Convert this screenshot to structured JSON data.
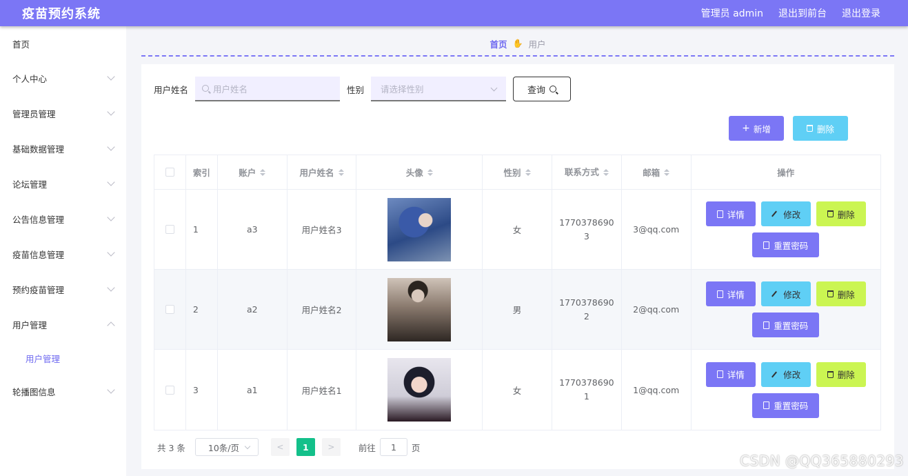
{
  "header": {
    "brand": "疫苗预约系统",
    "admin": "管理员 admin",
    "to_front": "退出到前台",
    "logout": "退出登录"
  },
  "sidebar": {
    "home": "首页",
    "items": [
      {
        "label": "个人中心"
      },
      {
        "label": "管理员管理"
      },
      {
        "label": "基础数据管理"
      },
      {
        "label": "论坛管理"
      },
      {
        "label": "公告信息管理"
      },
      {
        "label": "疫苗信息管理"
      },
      {
        "label": "预约疫苗管理"
      },
      {
        "label": "用户管理",
        "expanded": true
      },
      {
        "label": "轮播图信息"
      }
    ],
    "submenu": "用户管理"
  },
  "breadcrumb": {
    "home": "首页",
    "current": "用户"
  },
  "search": {
    "name_label": "用户姓名",
    "name_placeholder": "用户姓名",
    "gender_label": "性别",
    "gender_placeholder": "请选择性别",
    "query_label": "查询"
  },
  "actions": {
    "add": "新增",
    "delete": "删除"
  },
  "table": {
    "columns": [
      "索引",
      "账户",
      "用户姓名",
      "头像",
      "性别",
      "联系方式",
      "邮箱",
      "操作"
    ],
    "rows": [
      {
        "index": "1",
        "account": "a3",
        "name": "用户姓名3",
        "gender": "女",
        "phone_a": "1770378690",
        "phone_b": "3",
        "email": "3@qq.com"
      },
      {
        "index": "2",
        "account": "a2",
        "name": "用户姓名2",
        "gender": "男",
        "phone_a": "1770378690",
        "phone_b": "2",
        "email": "2@qq.com"
      },
      {
        "index": "3",
        "account": "a1",
        "name": "用户姓名1",
        "gender": "女",
        "phone_a": "1770378690",
        "phone_b": "1",
        "email": "1@qq.com"
      }
    ],
    "ops": {
      "detail": "详情",
      "edit": "修改",
      "delete": "删除",
      "reset": "重置密码"
    }
  },
  "pagination": {
    "total": "共 3 条",
    "page_size": "10条/页",
    "prev": "<",
    "current_page": "1",
    "next": ">",
    "goto_label": "前往",
    "goto_value": "1",
    "goto_suffix": "页"
  },
  "watermark": "CSDN @QQ365880293",
  "colors": {
    "primary": "#7b76f5",
    "info": "#5fcff5",
    "lime": "#cbf552",
    "page_active": "#13c08a"
  }
}
